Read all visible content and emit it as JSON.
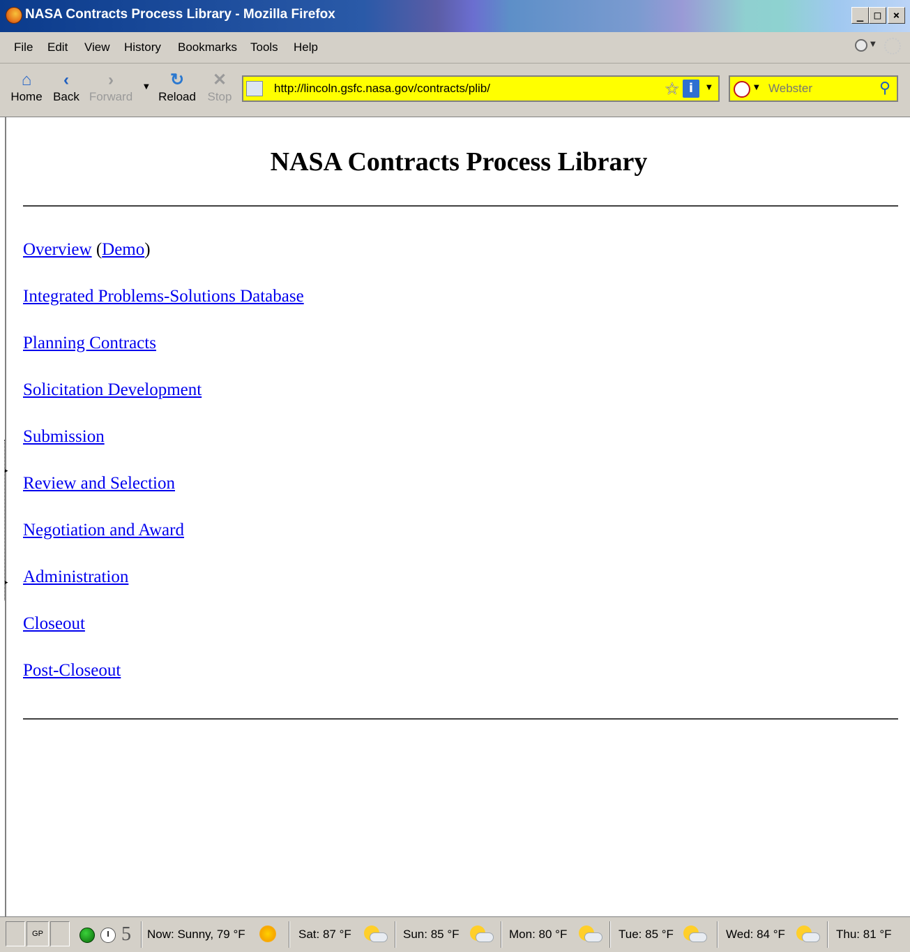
{
  "window": {
    "title": "NASA Contracts Process Library - Mozilla Firefox",
    "controls": {
      "minimize": "_",
      "maximize": "□",
      "close": "×"
    }
  },
  "menu": {
    "file": "File",
    "edit": "Edit",
    "view": "View",
    "history": "History",
    "bookmarks": "Bookmarks",
    "tools": "Tools",
    "help": "Help"
  },
  "toolbar": {
    "home": "Home",
    "back": "Back",
    "forward": "Forward",
    "reload": "Reload",
    "stop": "Stop"
  },
  "urlbar": {
    "url": "http://lincoln.gsfc.nasa.gov/contracts/plib/",
    "background": "#ffff00"
  },
  "search": {
    "placeholder": "Webster"
  },
  "page": {
    "heading": "NASA Contracts Process Library",
    "links": {
      "overview": "Overview",
      "demo": "Demo",
      "integrated": "Integrated Problems-Solutions Database",
      "planning": "Planning Contracts",
      "solicitation": "Solicitation Development",
      "submission": "Submission",
      "review": "Review and Selection",
      "negotiation": "Negotiation and Award",
      "administration": "Administration",
      "closeout": "Closeout",
      "post_closeout": "Post-Closeout"
    },
    "paren_open": "(",
    "paren_close": ")",
    "link_color": "#0000ee"
  },
  "statusbar": {
    "gp": "GP",
    "count": "5",
    "weather": {
      "now": "Now: Sunny, 79 °F",
      "sat": "Sat: 87 °F",
      "sun": "Sun: 85 °F",
      "mon": "Mon: 80 °F",
      "tue": "Tue: 85 °F",
      "wed": "Wed: 84 °F",
      "thu": "Thu: 81 °F"
    }
  },
  "icons": {
    "firefox": "firefox-icon",
    "home": "home-icon",
    "back": "back-arrow-icon",
    "forward": "forward-arrow-icon",
    "reload": "reload-icon",
    "stop": "stop-icon",
    "bookmark_star": "star-icon",
    "info": "info-icon",
    "search_go": "magnifier-icon"
  }
}
